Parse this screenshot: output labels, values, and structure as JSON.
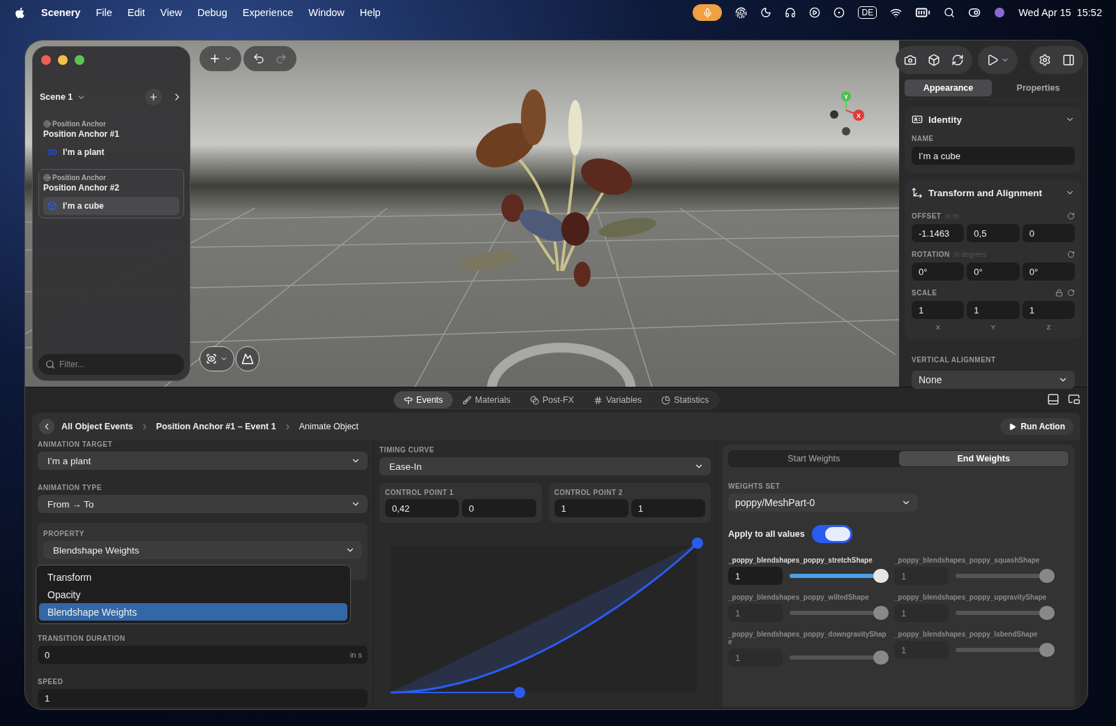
{
  "menubar": {
    "app": "Scenery",
    "menus": [
      "File",
      "Edit",
      "View",
      "Debug",
      "Experience",
      "Window",
      "Help"
    ],
    "input_source": "DE",
    "clock": "Wed Apr 15  15:52"
  },
  "sidebar": {
    "scene": "Scene 1",
    "groups": [
      {
        "type_label": "Position Anchor",
        "title": "Position Anchor #1",
        "selected": false,
        "items": [
          {
            "kind": "model",
            "badge": "3D",
            "label": "I’m a plant",
            "selected": false
          }
        ]
      },
      {
        "type_label": "Position Anchor",
        "title": "Position Anchor #2",
        "selected": true,
        "items": [
          {
            "kind": "shape",
            "label": "I’m a cube",
            "selected": true
          }
        ]
      }
    ],
    "filter": {
      "placeholder": "Filter..."
    }
  },
  "viewport": {
    "gizmo": {
      "y": "Y",
      "x": "X"
    }
  },
  "inspector": {
    "tabs": [
      {
        "label": "Appearance",
        "selected": true
      },
      {
        "label": "Properties",
        "selected": false
      }
    ],
    "identity": {
      "title": "Identity",
      "name_label": "NAME",
      "name": "I’m a cube"
    },
    "transform": {
      "title": "Transform and Alignment",
      "rows": [
        {
          "label": "OFFSET",
          "unit": "in m",
          "values": [
            "-1.1463",
            "0,5",
            "0"
          ],
          "locked": false
        },
        {
          "label": "ROTATION",
          "unit": "in degrees",
          "values": [
            "0°",
            "0°",
            "0°"
          ],
          "locked": false
        },
        {
          "label": "SCALE",
          "values": [
            "1",
            "1",
            "1"
          ],
          "locked": true
        }
      ],
      "axes": [
        "X",
        "Y",
        "Z"
      ]
    },
    "vertical_alignment": {
      "label": "VERTICAL ALIGNMENT",
      "value": "None"
    }
  },
  "bottom_tabs": [
    {
      "kind": "events",
      "label": "Events",
      "selected": true
    },
    {
      "kind": "materials",
      "label": "Materials",
      "selected": false
    },
    {
      "kind": "postfx",
      "label": "Post-FX",
      "selected": false
    },
    {
      "kind": "variables",
      "label": "Variables",
      "selected": false
    },
    {
      "kind": "statistics",
      "label": "Statistics",
      "selected": false
    }
  ],
  "breadcrumb": [
    "All Object Events",
    "Position Anchor #1 – Event 1",
    "Animate Object"
  ],
  "run_action": "Run Action",
  "animation": {
    "target": {
      "label": "ANIMATION TARGET",
      "value": "I’m a plant"
    },
    "type": {
      "label": "ANIMATION TYPE",
      "value": "From → To"
    },
    "property": {
      "label": "PROPERTY",
      "value": "Blendshape Weights",
      "options": [
        {
          "label": "Transform",
          "selected": false
        },
        {
          "label": "Opacity",
          "selected": false
        },
        {
          "label": "Blendshape Weights",
          "selected": true
        }
      ]
    },
    "transition": {
      "label": "TRANSITION DURATION",
      "value": "0",
      "unit": "in s"
    },
    "speed": {
      "label": "SPEED",
      "value": "1"
    }
  },
  "timing": {
    "label": "TIMING CURVE",
    "value": "Ease-In",
    "points": [
      {
        "label": "CONTROL POINT 1",
        "values": [
          "0,42",
          "0"
        ]
      },
      {
        "label": "CONTROL POINT 2",
        "values": [
          "1",
          "1"
        ]
      }
    ]
  },
  "weights": {
    "tabs": [
      {
        "label": "Start Weights",
        "selected": false
      },
      {
        "label": "End Weights",
        "selected": true
      }
    ],
    "set_label": "WEIGHTS SET",
    "set": "poppy/MeshPart-0",
    "apply_label": "Apply to all values",
    "apply_all": true,
    "shapes": [
      {
        "name": "_poppy_blendshapes_poppy_stretchShape",
        "value": "1",
        "level": 1,
        "disabled": false
      },
      {
        "name": "_poppy_blendshapes_poppy_squashShape",
        "value": "1",
        "level": 1,
        "disabled": true
      },
      {
        "name": "_poppy_blendshapes_poppy_wiltedShape",
        "value": "1",
        "level": 1,
        "disabled": true
      },
      {
        "name": "_poppy_blendshapes_poppy_upgravityShape",
        "value": "1",
        "level": 1,
        "disabled": true
      },
      {
        "name": "_poppy_blendshapes_poppy_downgravityShape",
        "value": "1",
        "level": 1,
        "disabled": true
      },
      {
        "name": "_poppy_blendshapes_poppy_lsbendShape",
        "value": "1",
        "level": 1,
        "disabled": true
      }
    ]
  }
}
